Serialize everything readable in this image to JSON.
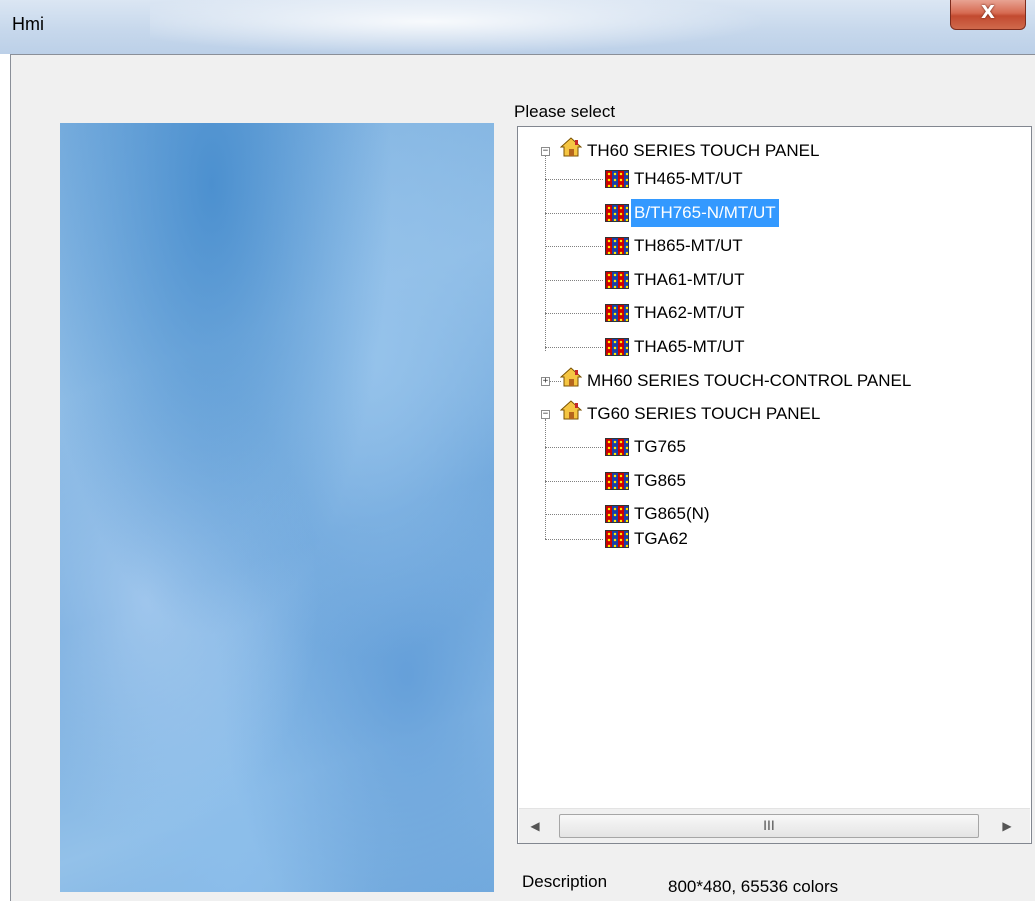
{
  "window": {
    "title": "Hmi",
    "close_glyph": "X"
  },
  "tree": {
    "label": "Please select",
    "groups": [
      {
        "label": "TH60 SERIES TOUCH PANEL",
        "expanded": true,
        "expander": "−",
        "items": [
          "TH465-MT/UT",
          "B/TH765-N/MT/UT",
          "TH865-MT/UT",
          "THA61-MT/UT",
          "THA62-MT/UT",
          "THA65-MT/UT"
        ]
      },
      {
        "label": "MH60 SERIES TOUCH-CONTROL PANEL",
        "expanded": false,
        "expander": "+",
        "items": []
      },
      {
        "label": "TG60 SERIES TOUCH PANEL",
        "expanded": true,
        "expander": "−",
        "items": [
          "TG765",
          "TG865",
          "TG865(N)",
          "TGA62"
        ]
      }
    ],
    "selected": "B/TH765-N/MT/UT",
    "scrollbar": {
      "left_arrow": "◀",
      "right_arrow": "▶",
      "thumb_grip": "III"
    }
  },
  "description": {
    "label": "Description",
    "value": "800*480, 65536 colors"
  },
  "colors": {
    "selection": "#3399ff",
    "close_button": "#c24a30"
  }
}
